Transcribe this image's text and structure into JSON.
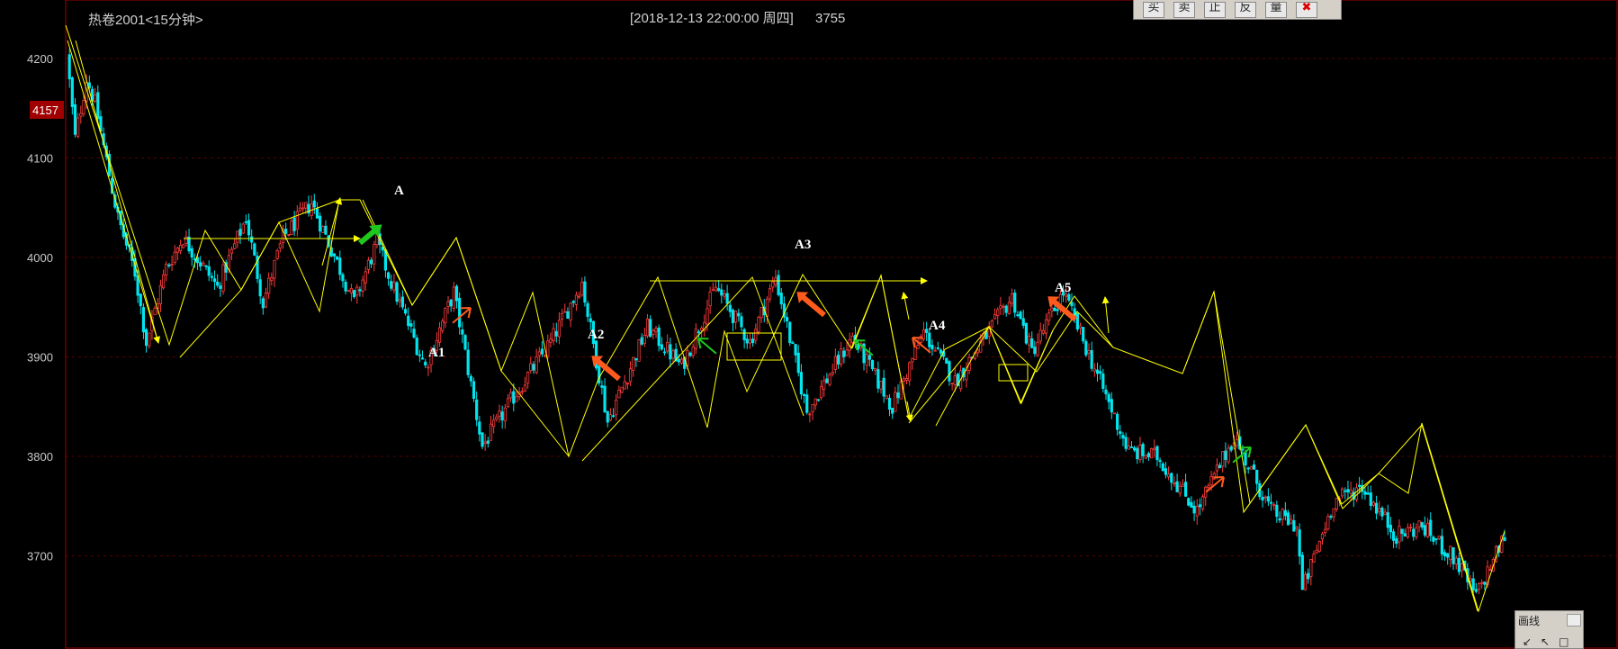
{
  "header": {
    "instrument": "热卷2001<15分钟>",
    "datetime": "[2018-12-13  22:00:00 周四]",
    "price": "3755"
  },
  "price_badge": "4157",
  "toolbar": {
    "buttons": [
      "买",
      "卖",
      "止",
      "反",
      "量"
    ]
  },
  "draw_panel": {
    "title": "画线"
  },
  "colors": {
    "background": "#000000",
    "up_candle": "#ff3b3b",
    "down_candle": "#00e5ee",
    "trend_line": "#ffff00",
    "grid": "#5a0000",
    "frame": "#a00000",
    "badge_bg": "#a00000",
    "arrow_orange": "#ff5a1e",
    "arrow_green": "#1ec81e"
  },
  "chart_data": {
    "type": "candlestick",
    "ylim": [
      3640,
      4220
    ],
    "yticks": [
      4200,
      4100,
      4000,
      3900,
      3800,
      3700
    ],
    "grid": true,
    "price_path": [
      [
        0,
        4205
      ],
      [
        3,
        4120
      ],
      [
        7,
        4180
      ],
      [
        10,
        4155
      ],
      [
        18,
        4040
      ],
      [
        24,
        3985
      ],
      [
        28,
        3915
      ],
      [
        35,
        3990
      ],
      [
        41,
        4020
      ],
      [
        53,
        3970
      ],
      [
        63,
        4040
      ],
      [
        69,
        3955
      ],
      [
        76,
        4020
      ],
      [
        86,
        4055
      ],
      [
        92,
        4015
      ],
      [
        101,
        3955
      ],
      [
        109,
        4015
      ],
      [
        114,
        3975
      ],
      [
        126,
        3890
      ],
      [
        136,
        3965
      ],
      [
        146,
        3810
      ],
      [
        157,
        3860
      ],
      [
        170,
        3915
      ],
      [
        181,
        3975
      ],
      [
        190,
        3835
      ],
      [
        204,
        3930
      ],
      [
        216,
        3890
      ],
      [
        228,
        3970
      ],
      [
        240,
        3915
      ],
      [
        249,
        3980
      ],
      [
        260,
        3845
      ],
      [
        276,
        3920
      ],
      [
        290,
        3850
      ],
      [
        301,
        3925
      ],
      [
        312,
        3875
      ],
      [
        332,
        3960
      ],
      [
        339,
        3905
      ],
      [
        350,
        3965
      ],
      [
        373,
        3805
      ],
      [
        383,
        3800
      ],
      [
        397,
        3745
      ],
      [
        410,
        3820
      ],
      [
        423,
        3745
      ],
      [
        432,
        3730
      ],
      [
        434,
        3665
      ],
      [
        445,
        3755
      ],
      [
        455,
        3770
      ],
      [
        467,
        3720
      ],
      [
        476,
        3730
      ],
      [
        488,
        3695
      ],
      [
        495,
        3660
      ],
      [
        505,
        3720
      ]
    ],
    "wave_labels": [
      "A",
      "A1",
      "A2",
      "A3",
      "A4",
      "A5"
    ]
  }
}
